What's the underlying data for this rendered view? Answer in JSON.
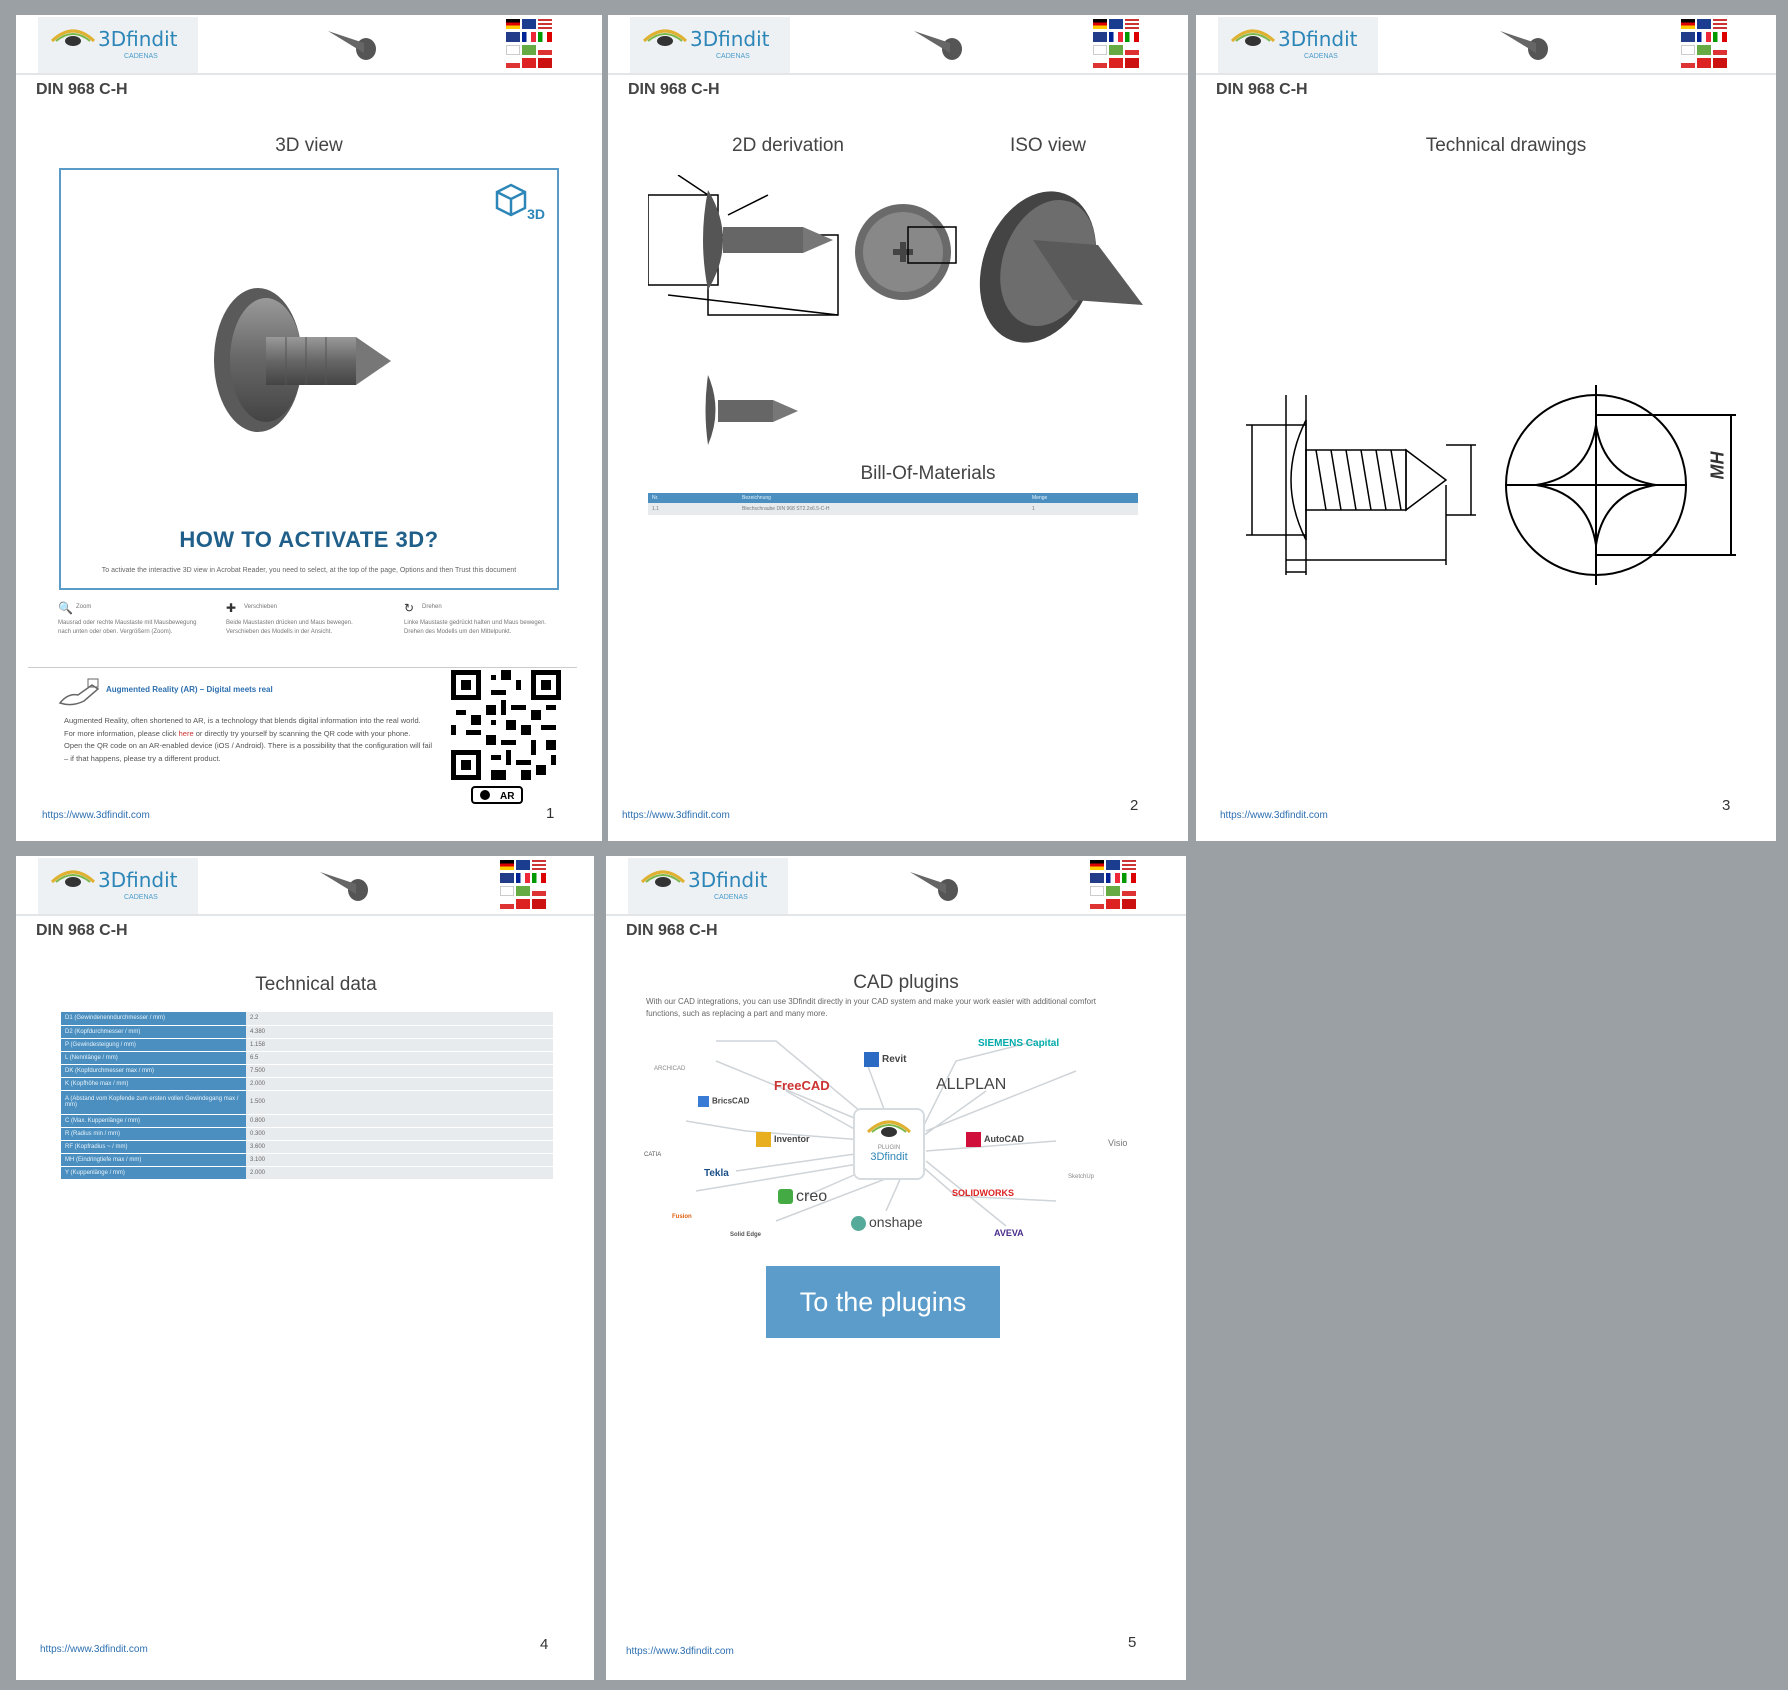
{
  "document": {
    "brand": "3Dfindit",
    "brand_sub": "CADENAS",
    "part_title": "DIN 968 C-H",
    "footer_url": "https://www.3dfindit.com"
  },
  "page1": {
    "section": "3D view",
    "badge": "3D",
    "activate_title": "HOW TO ACTIVATE 3D?",
    "activate_text": "To activate the interactive 3D view in Acrobat Reader, you need to select, at the top of the page, Options and then Trust this document",
    "tips": [
      {
        "icon": "zoom-icon",
        "label": "Zoom",
        "text": "Mausrad oder rechte Maustaste mit Mausbewegung nach unten oder oben. Vergrößern (Zoom)."
      },
      {
        "icon": "move-icon",
        "label": "Verschieben",
        "text": "Beide Maustasten drücken und Maus bewegen. Verschieben des Modells in der Ansicht."
      },
      {
        "icon": "rotate-icon",
        "label": "Drehen",
        "text": "Linke Maustaste gedrückt halten und Maus bewegen. Drehen des Modells um den Mittelpunkt."
      }
    ],
    "ar_title": "Augmented Reality (AR) – Digital meets real",
    "ar_text_1": "Augmented Reality, often shortened to AR, is a technology that blends digital information into the real world. For more information, please click",
    "ar_link": "here",
    "ar_text_2": "or directly try yourself by scanning the QR code with your phone.",
    "ar_text_3": "Open the QR code on an AR-enabled device (iOS / Android). There is a possibility that the configuration will fail – if that happens, please try a different product.",
    "page_number": "1"
  },
  "page2": {
    "section_left": "2D derivation",
    "section_right": "ISO view",
    "bom_title": "Bill-Of-Materials",
    "bom_headers": [
      "Nr.",
      "Bezeichnung",
      "Menge"
    ],
    "bom_rows": [
      [
        "1.1",
        "Blechschraube DIN 968 ST2.2x6.5-C-H",
        "1"
      ]
    ],
    "page_number": "2"
  },
  "page3": {
    "section": "Technical drawings",
    "dim_mh": "MH",
    "page_number": "3"
  },
  "page4": {
    "section": "Technical data",
    "rows": [
      {
        "k": "D1 (Gewindenenndurchmesser / mm)",
        "v": "2.2"
      },
      {
        "k": "D2 (Kopfdurchmesser / mm)",
        "v": "4.380"
      },
      {
        "k": "P (Gewindesteigung / mm)",
        "v": "1.158"
      },
      {
        "k": "L (Nennlänge / mm)",
        "v": "6.5"
      },
      {
        "k": "DK (Kopfdurchmesser max / mm)",
        "v": "7.500"
      },
      {
        "k": "K (Kopfhöhe max / mm)",
        "v": "2.000"
      },
      {
        "k": "A (Abstand vom Kopfende zum ersten vollen Gewindegang max / mm)",
        "v": "1.500"
      },
      {
        "k": "C (Max. Kuppenlänge / mm)",
        "v": "0.800"
      },
      {
        "k": "R (Radius min / mm)",
        "v": "0.300"
      },
      {
        "k": "RF (Kopfradius ~ / mm)",
        "v": "3.600"
      },
      {
        "k": "MH (Eindringtiefe max / mm)",
        "v": "3.100"
      },
      {
        "k": "Y (Kuppenlänge / mm)",
        "v": "2.000"
      }
    ],
    "page_number": "4"
  },
  "page5": {
    "section": "CAD plugins",
    "intro": "With our CAD integrations, you can use 3Dfindit directly in your CAD system and make your work easier with additional comfort functions, such as replacing a part and many more.",
    "hub_label": "3Dfindit",
    "hub_sub": "PLUGIN",
    "plugins": [
      "Revit",
      "SIEMENS Capital",
      "FreeCAD",
      "ALLPLAN",
      "BricsCAD",
      "Inventor",
      "AutoCAD",
      "Tekla",
      "creo",
      "SOLIDWORKS",
      "onshape",
      "AVEVA",
      "ARCHICAD",
      "Fusion",
      "CATIA",
      "Visio",
      "SketchUp",
      "Solid Edge"
    ],
    "button": "To the plugins",
    "page_number": "5"
  },
  "colors": {
    "accent": "#2d86b8",
    "button": "#5c9ccb",
    "background": "#9aa0a4",
    "table_key": "#4a8fc0"
  }
}
